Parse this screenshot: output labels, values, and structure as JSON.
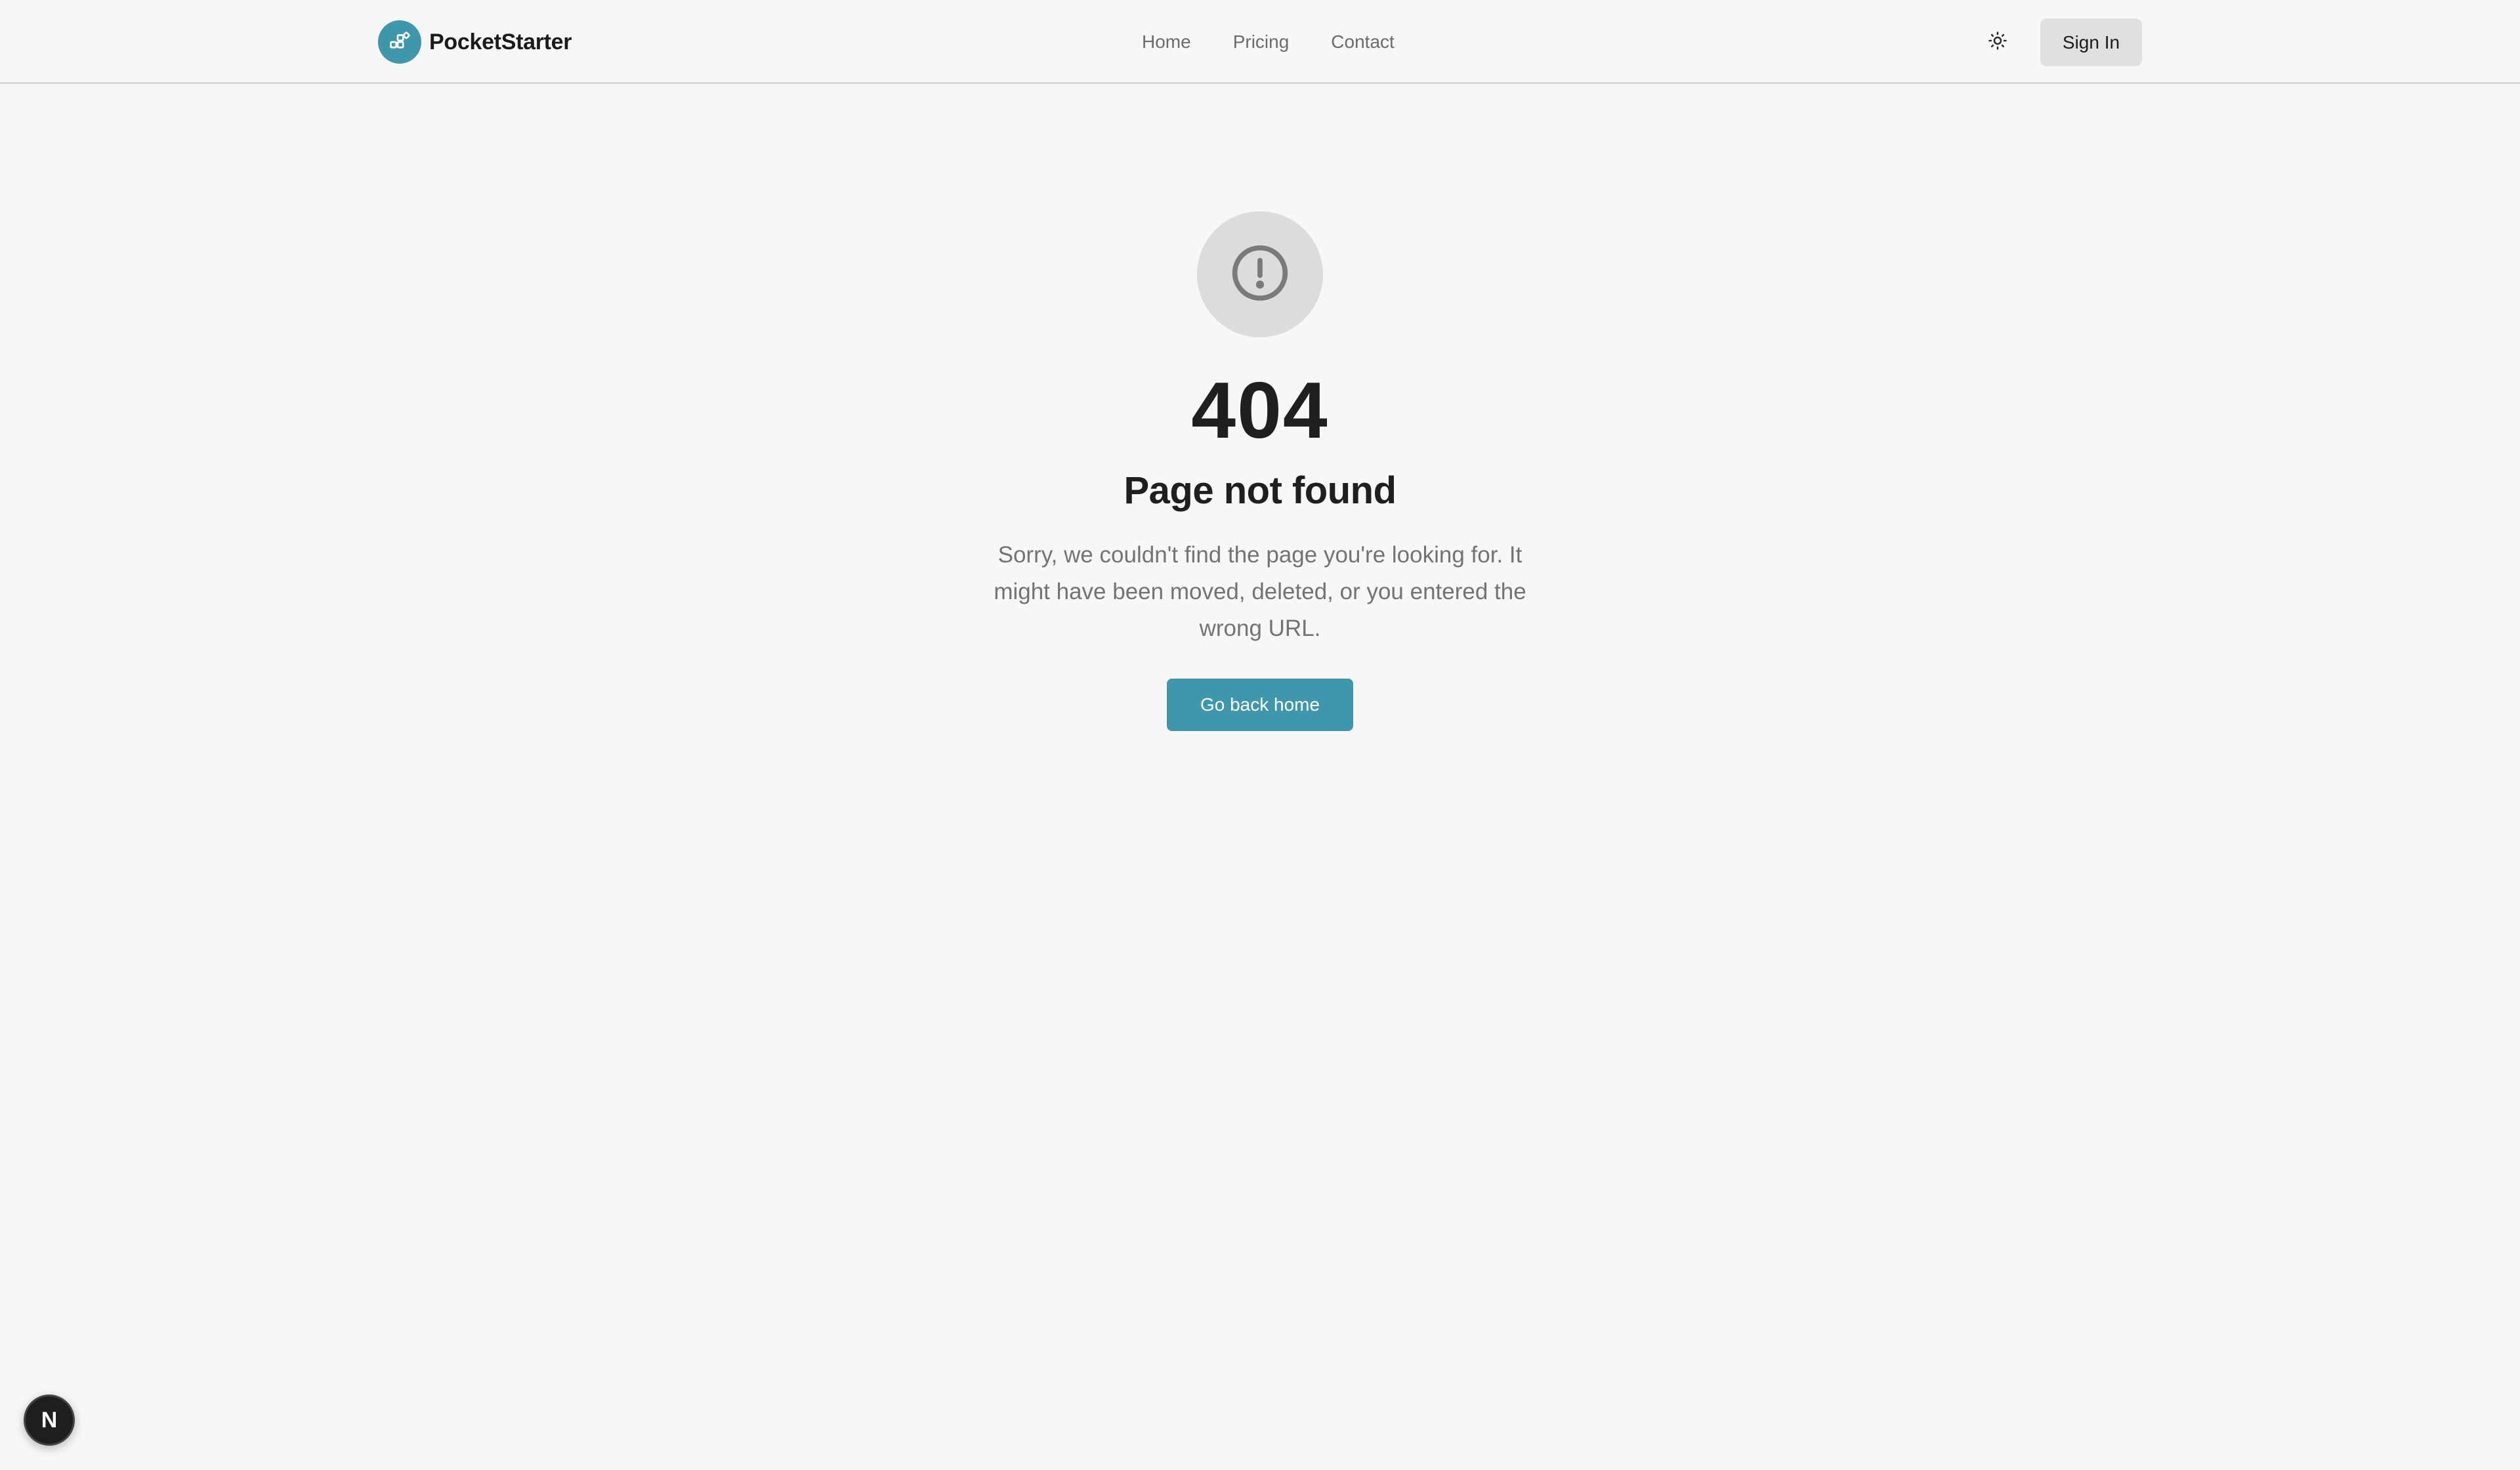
{
  "header": {
    "brand_name": "PocketStarter",
    "brand_icon": "blocks-icon",
    "nav": [
      {
        "label": "Home"
      },
      {
        "label": "Pricing"
      },
      {
        "label": "Contact"
      }
    ],
    "theme_icon": "sun-icon",
    "signin_label": "Sign In"
  },
  "main": {
    "icon": "exclamation-circle-icon",
    "code": "404",
    "title": "Page not found",
    "message": "Sorry, we couldn't find the page you're looking for. It might have been moved, deleted, or you entered the wrong URL.",
    "home_button_label": "Go back home"
  },
  "dev_badge": {
    "letter": "N",
    "icon": "nextjs-icon"
  },
  "colors": {
    "accent": "#3f97ab",
    "background": "#f7f7f7",
    "muted_text": "#737373",
    "nav_text": "#6b6b6b"
  }
}
